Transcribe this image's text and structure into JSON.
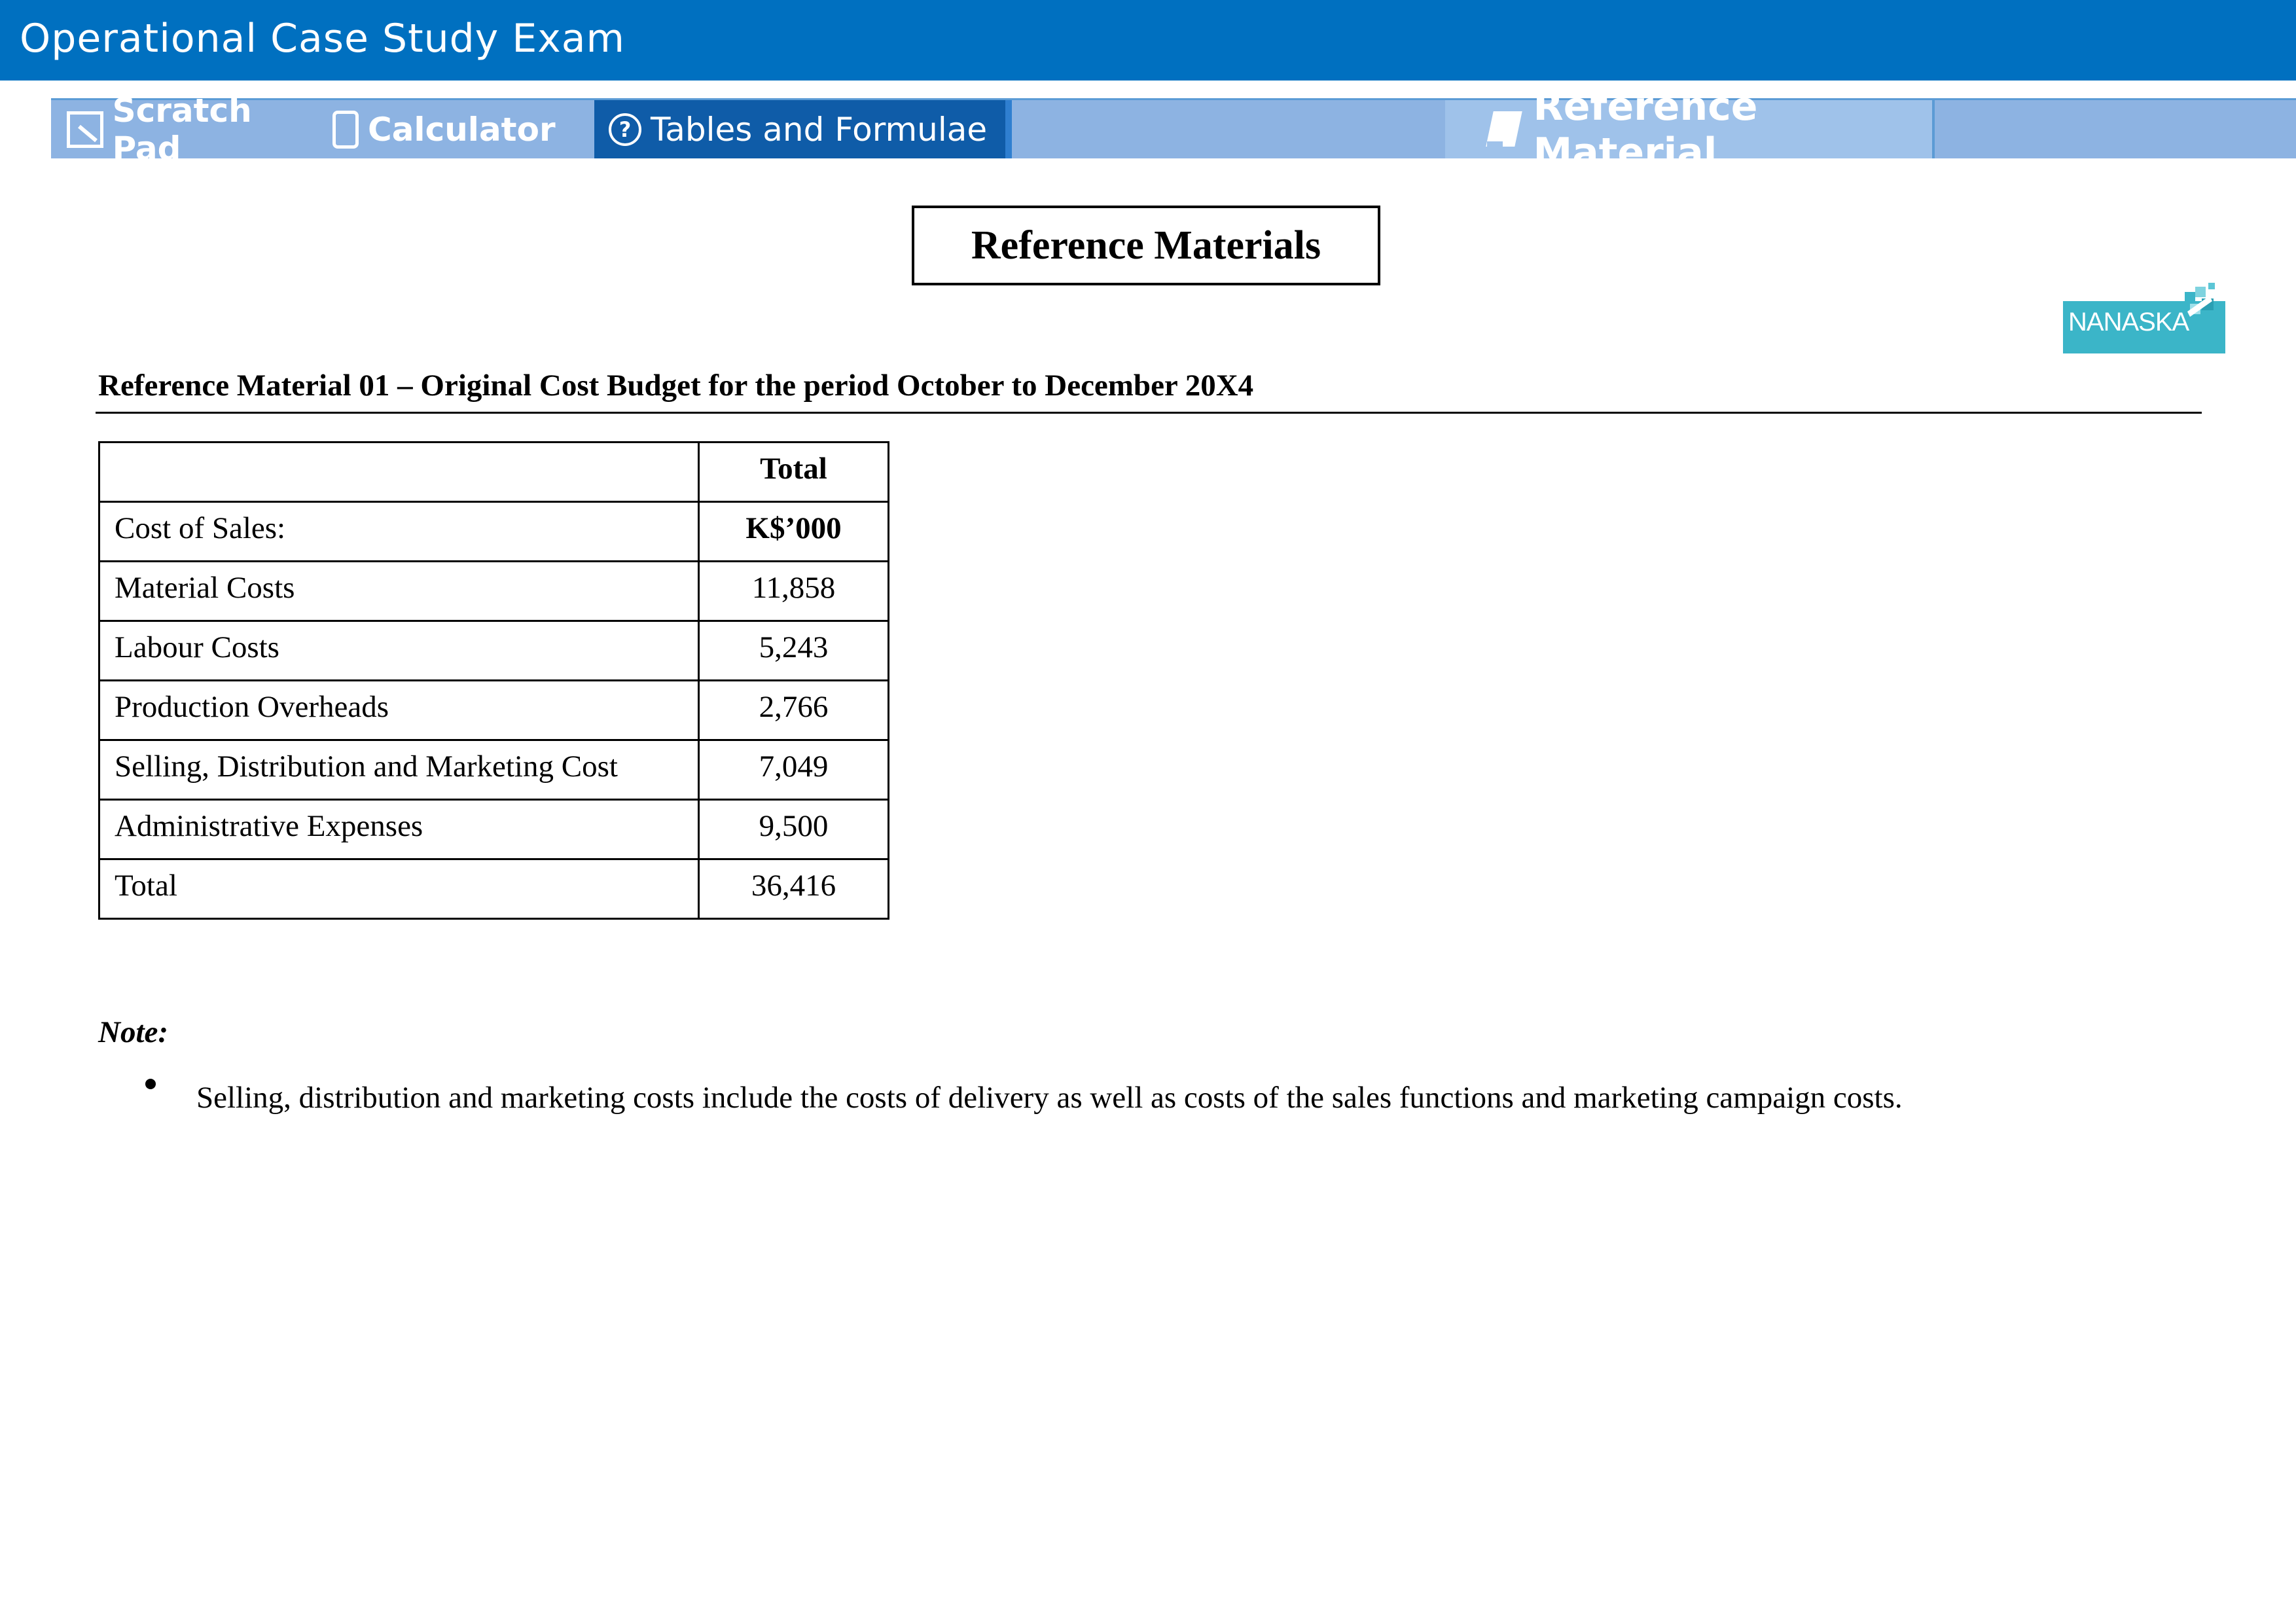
{
  "window": {
    "title": "Operational Case Study Exam"
  },
  "toolbar": {
    "scratch_pad": "Scratch Pad",
    "calculator": "Calculator",
    "tables_formulae": "Tables and Formulae",
    "reference_material": "Reference Material"
  },
  "page": {
    "heading": "Reference Materials",
    "logo_text": "NANASKA",
    "section_title": "Reference Material 01 – Original Cost Budget for the period October to December 20X4"
  },
  "budget_table": {
    "header_total": "Total",
    "rows": [
      {
        "label": "Cost of Sales:",
        "value": "K$’000"
      },
      {
        "label": "Material Costs",
        "value": "11,858"
      },
      {
        "label": "Labour Costs",
        "value": "5,243"
      },
      {
        "label": "Production Overheads",
        "value": "2,766"
      },
      {
        "label": "Selling, Distribution and Marketing Cost",
        "value": "7,049"
      },
      {
        "label": "Administrative Expenses",
        "value": "9,500"
      },
      {
        "label": "Total",
        "value": "36,416"
      }
    ]
  },
  "note": {
    "label": "Note:",
    "items": [
      "Selling, distribution and marketing costs include the costs of delivery as well as costs of the sales functions and marketing campaign costs."
    ]
  },
  "colors": {
    "title_bar": "#0070c0",
    "toolbar": "#8db3e2",
    "active_tab": "#0f5ca8",
    "logo": "#3bb5c8"
  },
  "icons": {
    "scratch_pad": "scratch-pad-icon",
    "calculator": "calculator-icon",
    "tables_formulae": "help-icon",
    "reference_material": "reference-icon"
  }
}
